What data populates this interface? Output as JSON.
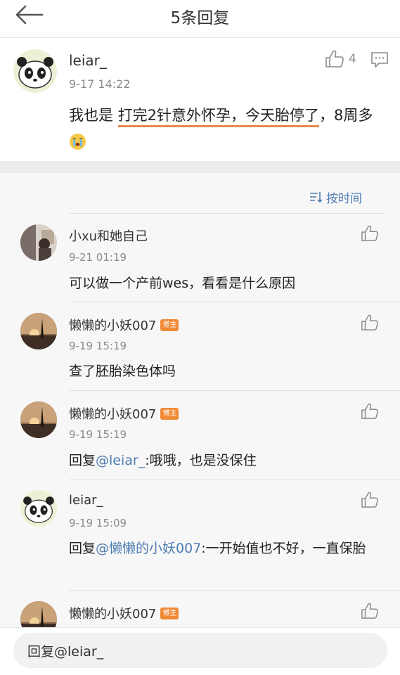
{
  "header": {
    "title": "5条回复",
    "back_icon": "arrow-left-icon"
  },
  "root_comment": {
    "user": "leiar_",
    "time": "9-17 14:22",
    "likes": "4",
    "text_before": "我也是 ",
    "text_highlight": "打完2针意外怀孕，今天胎停了",
    "text_after": "，8周多",
    "emoji": "crying-face-emoji",
    "highlight_color": "#e8894a"
  },
  "sort": {
    "label": "按时间",
    "icon": "sort-icon"
  },
  "replies": [
    {
      "user": "小xu和她自己",
      "badge": "",
      "time": "9-21 01:19",
      "text_prefix": "可以做一个产前wes，看看是什么原因",
      "mention": "",
      "text_suffix": ""
    },
    {
      "user": "懒懒的小妖007",
      "badge": "博主",
      "time": "9-19 15:19",
      "text_prefix": "查了胚胎染色体吗",
      "mention": "",
      "text_suffix": ""
    },
    {
      "user": "懒懒的小妖007",
      "badge": "博主",
      "time": "9-19 15:19",
      "text_prefix": "回复",
      "mention": "@leiar_",
      "text_suffix": ":哦哦，也是没保住"
    },
    {
      "user": "leiar_",
      "badge": "",
      "time": "9-19 15:09",
      "text_prefix": "回复",
      "mention": "@懒懒的小妖007",
      "text_suffix": ":一开始值也不好，一直保胎"
    },
    {
      "user": "懒懒的小妖007",
      "badge": "博主",
      "time": "",
      "text_prefix": "",
      "mention": "",
      "text_suffix": ""
    }
  ],
  "reply_box": {
    "placeholder": "回复@leiar_"
  },
  "colors": {
    "link": "#4e7cb2",
    "badge": "#f08a35",
    "divider": "#ececec",
    "background": "#f7f7f7"
  }
}
